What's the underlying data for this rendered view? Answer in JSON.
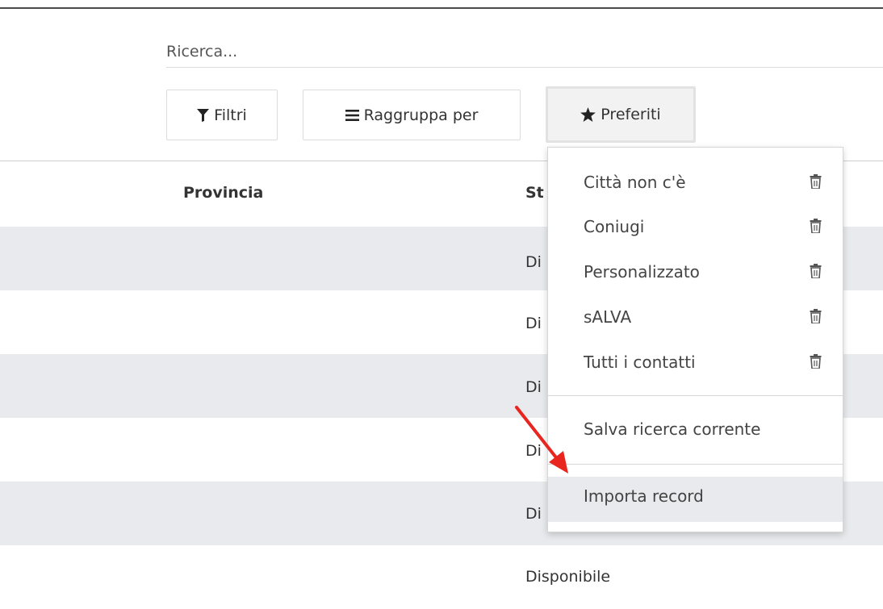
{
  "search": {
    "placeholder": "Ricerca..."
  },
  "toolbar": {
    "filters_label": "Filtri",
    "group_by_label": "Raggruppa per",
    "favorites_label": "Preferiti"
  },
  "table": {
    "columns": [
      "Provincia",
      "St"
    ],
    "rows": [
      {
        "provincia": "",
        "stato": "Di"
      },
      {
        "provincia": "",
        "stato": "Di"
      },
      {
        "provincia": "",
        "stato": "Di"
      },
      {
        "provincia": "",
        "stato": "Di"
      },
      {
        "provincia": "",
        "stato": "Di"
      },
      {
        "provincia": "",
        "stato": "Disponibile"
      }
    ]
  },
  "favorites_menu": {
    "saved_filters": [
      {
        "label": "Città non c'è",
        "icon": "trash-icon"
      },
      {
        "label": "Coniugi",
        "icon": "trash-icon"
      },
      {
        "label": "Personalizzato",
        "icon": "trash-icon"
      },
      {
        "label": "sALVA",
        "icon": "trash-icon"
      },
      {
        "label": "Tutti i contatti",
        "icon": "trash-icon"
      }
    ],
    "save_current_label": "Salva ricerca corrente",
    "import_records_label": "Importa record"
  },
  "colors": {
    "row_shade": "#e8eaed",
    "annotation_arrow": "#e8251f",
    "text": "#333333"
  },
  "icons": {
    "filters": "funnel-icon",
    "group_by": "bars-icon",
    "favorites": "star-icon"
  }
}
